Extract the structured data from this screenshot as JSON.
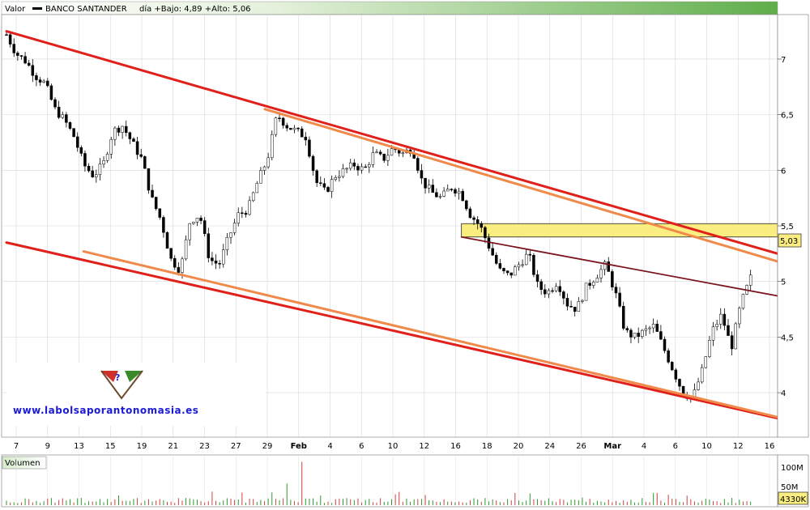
{
  "header": {
    "valor_label": "Valor",
    "instrument": "BANCO SANTANDER",
    "stats": "día +Bajo: 4,89 +Alto: 5,06"
  },
  "watermark": {
    "text": "www.labolsaporantonomasia.es"
  },
  "volume_panel": {
    "label": "Volumen"
  },
  "colors": {
    "channel_red": "#e0201b",
    "channel_orange": "#f08a4b",
    "trend_dark": "#7a1520",
    "resistance_zone": "#fbee80",
    "candle_up": "#2a9a2a",
    "candle_down": "#000000"
  },
  "chart_data": {
    "type": "line",
    "price": {
      "ylim": [
        3.6,
        7.4
      ],
      "yticks": [
        "7",
        "6,5",
        "6",
        "5,5",
        "5",
        "4,5",
        "4"
      ],
      "last_value_label": "5,03",
      "x_tick_labels": [
        "7",
        "9",
        "13",
        "15",
        "19",
        "21",
        "23",
        "27",
        "29",
        "Feb",
        "4",
        "6",
        "10",
        "12",
        "16",
        "18",
        "20",
        "24",
        "26",
        "Mar",
        "4",
        "6",
        "10",
        "12",
        "16"
      ],
      "close_series": [
        7.22,
        7.05,
        6.98,
        6.85,
        6.78,
        6.55,
        6.45,
        6.3,
        6.05,
        5.95,
        6.05,
        6.35,
        6.4,
        6.25,
        6.1,
        5.75,
        5.55,
        5.2,
        5.1,
        5.55,
        5.6,
        5.2,
        5.15,
        5.4,
        5.6,
        5.65,
        5.9,
        6.1,
        6.5,
        6.4,
        6.35,
        6.3,
        5.9,
        5.8,
        5.95,
        6.0,
        6.05,
        6.0,
        6.15,
        6.1,
        6.2,
        6.15,
        6.2,
        5.9,
        5.8,
        5.75,
        5.85,
        5.8,
        5.6,
        5.5,
        5.3,
        5.1,
        5.05,
        5.15,
        5.25,
        4.95,
        4.9,
        5.0,
        4.8,
        4.75,
        4.95,
        5.05,
        5.15,
        4.9,
        4.55,
        4.5,
        4.55,
        4.6,
        4.4,
        4.2,
        4.0,
        3.95,
        4.2,
        4.55,
        4.7,
        4.4,
        4.8,
        5.03
      ],
      "channel_upper_red": [
        [
          7.25,
          7.25
        ],
        [
          5.25,
          5.25
        ]
      ],
      "resistance_zone": [
        5.4,
        5.52
      ],
      "lines": [
        {
          "name": "canal-superior-rojo",
          "from": [
            0,
            7.25
          ],
          "to": [
            1,
            5.25
          ]
        },
        {
          "name": "canal-superior-naranja",
          "from": [
            0.335,
            6.55
          ],
          "to": [
            1,
            5.18
          ]
        },
        {
          "name": "canal-inferior-rojo",
          "from": [
            0,
            5.35
          ],
          "to": [
            1,
            3.77
          ]
        },
        {
          "name": "canal-inferior-naranja",
          "from": [
            0.1,
            5.27
          ],
          "to": [
            1,
            3.78
          ]
        },
        {
          "name": "tendencia-marron",
          "from": [
            0.59,
            5.4
          ],
          "to": [
            1,
            4.87
          ]
        }
      ]
    },
    "volume": {
      "ytick_labels": [
        "100M",
        "50M"
      ],
      "last_value_label": "4330K",
      "max": 130
    }
  }
}
